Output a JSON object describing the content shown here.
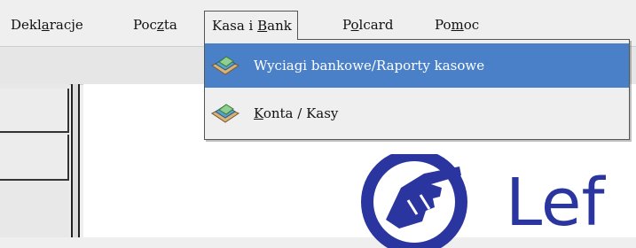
{
  "menubar": {
    "items": [
      {
        "pre": "Dekl",
        "u": "a",
        "post": "racje"
      },
      {
        "pre": "Poc",
        "u": "z",
        "post": "ta"
      },
      {
        "pre": "Kasa i ",
        "u": "B",
        "post": "ank"
      },
      {
        "pre": "P",
        "u": "o",
        "post": "lcard"
      },
      {
        "pre": "Po",
        "u": "m",
        "post": "oc"
      }
    ]
  },
  "dropdown": {
    "items": [
      {
        "pre": "",
        "u": "",
        "post": "Wyciagi bankowe/Raporty kasowe",
        "icon": "bank-statement-icon"
      },
      {
        "pre": "",
        "u": "K",
        "post": "onta / Kasy",
        "icon": "accounts-icon"
      }
    ]
  },
  "logo": {
    "text": "Lef"
  },
  "colors": {
    "selection": "#4a80c7",
    "logo_blue": "#2a35a0"
  }
}
